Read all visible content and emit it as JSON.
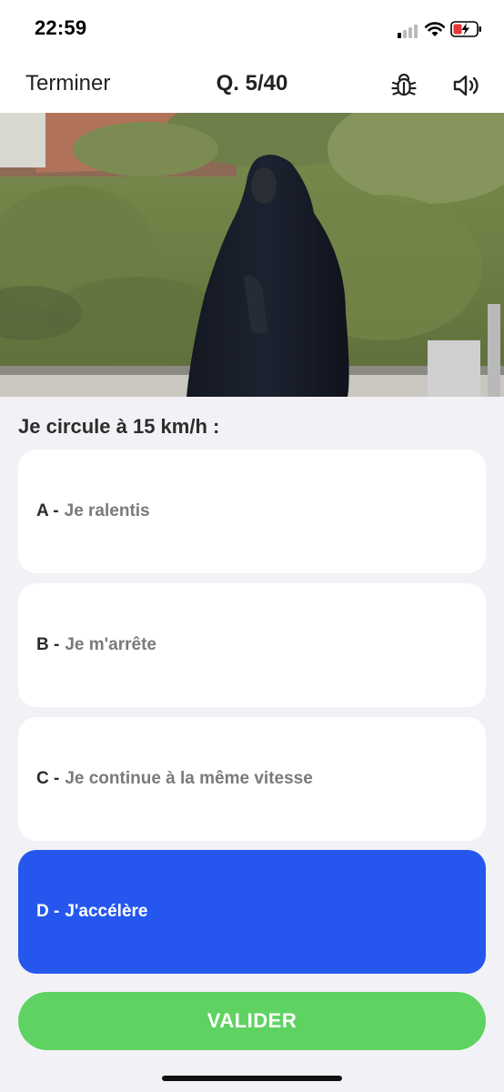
{
  "status_bar": {
    "time": "22:59"
  },
  "nav": {
    "finish_label": "Terminer",
    "question_counter": "Q. 5/40",
    "bug_icon": "bug-icon",
    "sound_icon": "speaker-icon"
  },
  "question": {
    "text": "Je circule à 15 km/h :"
  },
  "answers": [
    {
      "letter": "A -",
      "text": "Je ralentis",
      "selected": false
    },
    {
      "letter": "B -",
      "text": "Je m'arrête",
      "selected": false
    },
    {
      "letter": "C -",
      "text": "Je continue à la même vitesse",
      "selected": false
    },
    {
      "letter": "D -",
      "text": "J'accélère",
      "selected": true
    }
  ],
  "submit": {
    "label": "VALIDER"
  },
  "colors": {
    "selected": "#2557ef",
    "submit": "#5fd362",
    "background": "#f2f2f6"
  }
}
